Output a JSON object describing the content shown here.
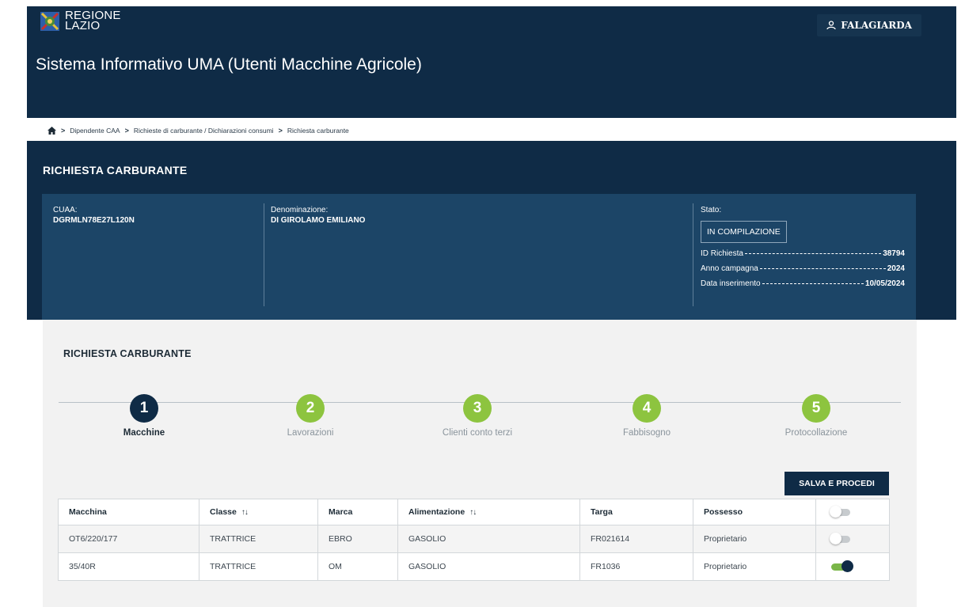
{
  "header": {
    "brand_line1": "REGIONE",
    "brand_line2": "LAZIO",
    "user_name": "FALAGIARDA",
    "app_title": "Sistema Informativo UMA (Utenti Macchine Agricole)"
  },
  "breadcrumb": {
    "items": [
      "Dipendente CAA",
      "Richieste di carburante / Dichiarazioni consumi",
      "Richiesta carburante"
    ],
    "separator": ">"
  },
  "request": {
    "title": "RICHIESTA CARBURANTE",
    "cuaa_label": "CUAA:",
    "cuaa_value": "DGRMLN78E27L120N",
    "denominazione_label": "Denominazione:",
    "denominazione_value": "DI GIROLAMO EMILIANO",
    "stato_label": "Stato:",
    "stato_value": "IN COMPILAZIONE",
    "meta": [
      {
        "label": "ID Richiesta",
        "value": "38794"
      },
      {
        "label": "Anno campagna",
        "value": "2024"
      },
      {
        "label": "Data inserimento",
        "value": "10/05/2024"
      }
    ]
  },
  "wizard": {
    "title": "RICHIESTA CARBURANTE",
    "steps": [
      {
        "number": "1",
        "label": "Macchine"
      },
      {
        "number": "2",
        "label": "Lavorazioni"
      },
      {
        "number": "3",
        "label": "Clienti conto terzi"
      },
      {
        "number": "4",
        "label": "Fabbisogno"
      },
      {
        "number": "5",
        "label": "Protocollazione"
      }
    ],
    "save_label": "SALVA E PROCEDI"
  },
  "table": {
    "columns": [
      "Macchina",
      "Classe",
      "Marca",
      "Alimentazione",
      "Targa",
      "Possesso"
    ],
    "sort_glyph": "↑↓",
    "rows": [
      {
        "macchina": "OT6/220/177",
        "classe": "TRATTRICE",
        "marca": "EBRO",
        "alimentazione": "GASOLIO",
        "targa": "FR021614",
        "possesso": "Proprietario",
        "selected": false
      },
      {
        "macchina": "35/40R",
        "classe": "TRATTRICE",
        "marca": "OM",
        "alimentazione": "GASOLIO",
        "targa": "FR1036",
        "possesso": "Proprietario",
        "selected": true
      }
    ]
  },
  "colors": {
    "primary": "#0f2b46",
    "panel": "#1c4567",
    "step_green": "#8dc43f",
    "toggle_on": "#7ab648"
  },
  "icons": [
    "regione-lazio-logo-icon",
    "user-icon",
    "home-icon",
    "sort-icon",
    "toggle-switch"
  ]
}
